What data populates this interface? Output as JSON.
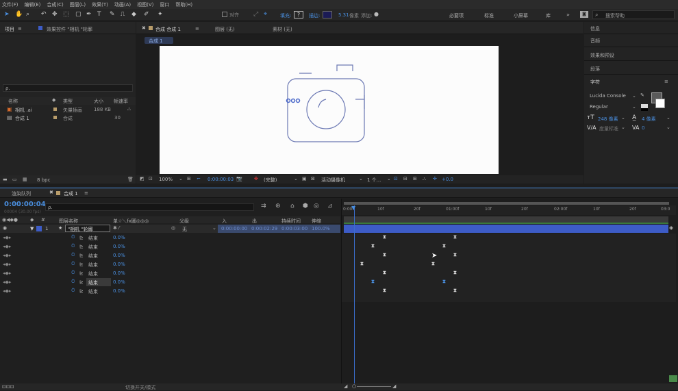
{
  "menu": [
    "文件(F)",
    "编辑(E)",
    "合成(C)",
    "图层(L)",
    "效果(T)",
    "动画(A)",
    "视图(V)",
    "窗口",
    "帮助(H)"
  ],
  "toolbar": {
    "align_label": "对齐",
    "fill_label": "填充:",
    "stroke_label": "描边:",
    "stroke_value": "5.31",
    "stroke_unit": "像素",
    "add_label": "添加:",
    "workspaces": [
      "必要项",
      "标准",
      "小屏幕",
      "库"
    ],
    "search_placeholder": "搜索帮助"
  },
  "project_panel": {
    "tab": "项目",
    "effects_tab": "效果控件 \"相机 \"轮廓",
    "search_placeholder": "ρ.",
    "columns": [
      "名称",
      "类型",
      "大小",
      "帧速率"
    ],
    "items": [
      {
        "name": "相机 .ai",
        "type": "矢量插画",
        "size": "188 KB",
        "fps": ""
      },
      {
        "name": "合成 1",
        "type": "合成",
        "size": "",
        "fps": "30"
      }
    ],
    "bpc": "8 bpc"
  },
  "viewer": {
    "comp_tab": "合成 合成 1",
    "layer_tab": "图层 (无)",
    "footage_tab": "素材 (无)",
    "breadcrumb": "合成 1",
    "zoom": "100%",
    "timecode": "0:00:00:03",
    "resolution": "(完整)",
    "camera": "活动摄像机",
    "views": "1 个...",
    "exposure": "+0.0"
  },
  "right_panel": {
    "sections": [
      "信息",
      "音频",
      "效果和预设",
      "段落"
    ],
    "character_title": "字符",
    "font": "Lucida Console",
    "style": "Regular",
    "size": "248 像素",
    "leading": "4 像素",
    "tracking": "度量标准",
    "tsume": "0"
  },
  "timeline": {
    "render_tab": "渲染队列",
    "comp_tab": "合成 1",
    "timecode": "0:00:00:04",
    "fps_sub": "00004 (30.00 fps)",
    "search_placeholder": "ρ.",
    "columns": {
      "layer_name": "图层名称",
      "switches": "单☆＼fx圖◎◎◎",
      "parent": "父级",
      "in": "入",
      "out": "出",
      "duration": "持续时间",
      "stretch": "伸缩"
    },
    "layer": {
      "index": "1",
      "name": "\"相机 \"轮廓",
      "parent": "无",
      "in": "0:00:00:00",
      "out": "0:00:02:29",
      "duration": "0:00:03:00",
      "stretch": "100.0%"
    },
    "sub_rows": [
      {
        "label": "结束",
        "value": "0.0%"
      },
      {
        "label": "结束",
        "value": "0.0%"
      },
      {
        "label": "结束",
        "value": "0.0%"
      },
      {
        "label": "结束",
        "value": "0.0%"
      },
      {
        "label": "结束",
        "value": "0.0%"
      },
      {
        "label": "结束",
        "value": "0.0%"
      },
      {
        "label": "结束",
        "value": "0.0%"
      }
    ],
    "ruler_labels": [
      "0:00f",
      "10f",
      "20f",
      "01:00f",
      "10f",
      "20f",
      "02:00f",
      "10f",
      "20f",
      "03:0"
    ],
    "footer": "切换开关/模式"
  }
}
